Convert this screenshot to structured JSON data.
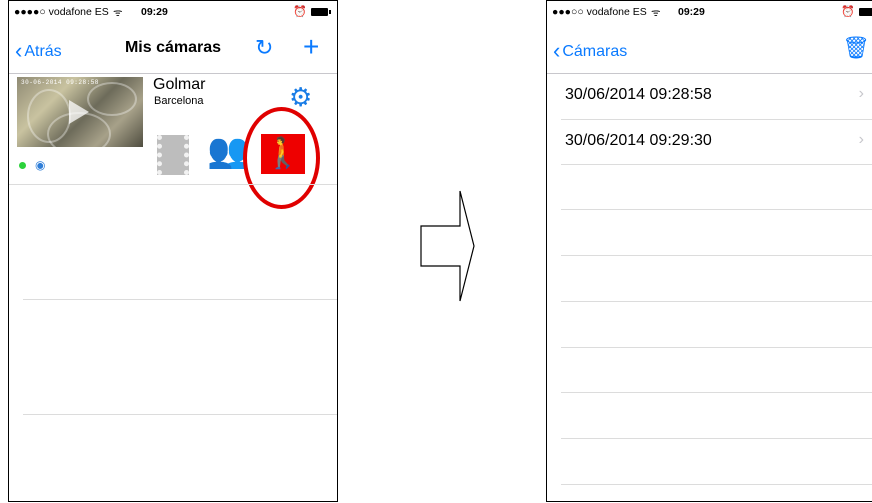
{
  "status_bar": {
    "left_carrier": "●●●●○ vodafone ES",
    "right_carrier": "●●●○○ vodafone ES",
    "time": "09:29"
  },
  "left_screen": {
    "nav": {
      "back_label": "Atrás",
      "title": "Mis cámaras"
    },
    "camera": {
      "name": "Golmar",
      "location": "Barcelona",
      "thumbnail_timestamp": "30-06-2014 09:28:58",
      "status_color": "#2bd23b",
      "motion_highlight_color": "#ee0000"
    }
  },
  "right_screen": {
    "nav": {
      "back_label": "Cámaras"
    },
    "recordings": [
      {
        "label": "30/06/2014 09:28:58"
      },
      {
        "label": "30/06/2014 09:29:30"
      }
    ]
  },
  "colors": {
    "accent": "#0a7aff",
    "gear": "#1a7de6",
    "highlight_ring": "#e00000"
  }
}
